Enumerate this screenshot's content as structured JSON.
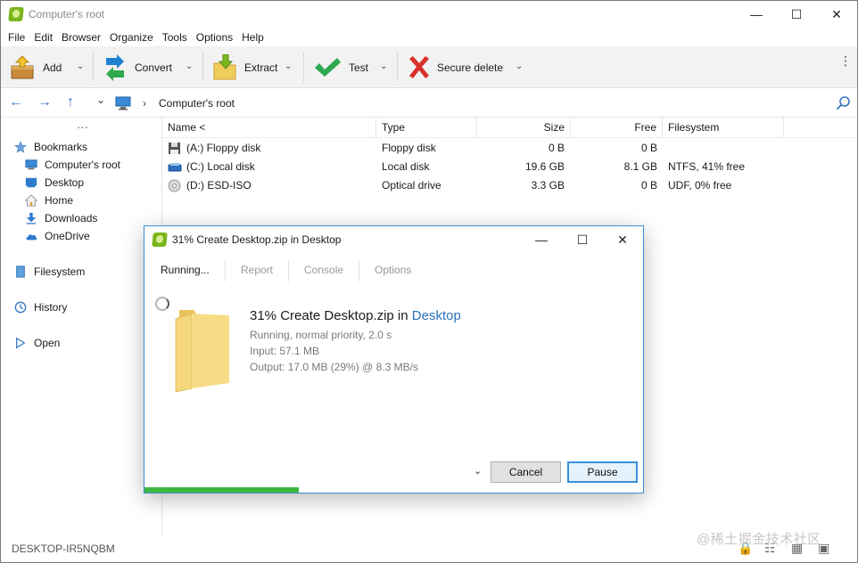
{
  "window": {
    "title": "Computer's root",
    "controls": {
      "minimize": "—",
      "maximize": "☐",
      "close": "✕"
    }
  },
  "menu": [
    "File",
    "Edit",
    "Browser",
    "Organize",
    "Tools",
    "Options",
    "Help"
  ],
  "toolbar": {
    "add": "Add",
    "convert": "Convert",
    "extract": "Extract",
    "test": "Test",
    "secure_delete": "Secure delete",
    "dropdown_glyph": "⌄",
    "more_glyph": "⋮"
  },
  "addressbar": {
    "back_glyph": "←",
    "forward_glyph": "→",
    "up_glyph": "↑",
    "history_glyph": "⌄",
    "separator_glyph": "›",
    "path": "Computer's root",
    "search_glyph": "⚲"
  },
  "sidebar": {
    "more_glyph": "···",
    "bookmarks_label": "Bookmarks",
    "bookmarks": [
      "Computer's root",
      "Desktop",
      "Home",
      "Downloads",
      "OneDrive"
    ],
    "filesystem_label": "Filesystem",
    "history_label": "History",
    "open_label": "Open"
  },
  "columns": [
    "Name <",
    "Type",
    "Size",
    "Free",
    "Filesystem"
  ],
  "rows": [
    {
      "name": "(A:) Floppy disk",
      "type": "Floppy disk",
      "size": "0 B",
      "free": "0 B",
      "filesystem": "",
      "icon": "floppy-icon"
    },
    {
      "name": "(C:) Local disk",
      "type": "Local disk",
      "size": "19.6 GB",
      "free": "8.1 GB",
      "filesystem": "NTFS, 41% free",
      "icon": "drive-icon"
    },
    {
      "name": "(D:) ESD-ISO",
      "type": "Optical drive",
      "size": "3.3 GB",
      "free": "0 B",
      "filesystem": "UDF, 0% free",
      "icon": "disc-icon"
    }
  ],
  "status": {
    "computer_name": "DESKTOP-IR5NQBM"
  },
  "dialog": {
    "title": "31% Create Desktop.zip in Desktop",
    "controls": {
      "minimize": "—",
      "maximize": "☐",
      "close": "✕"
    },
    "tabs": [
      "Running...",
      "Report",
      "Console",
      "Options"
    ],
    "job_title_prefix": "31% Create Desktop.zip in ",
    "job_title_link": "Desktop",
    "status_line": "Running, normal priority, 2.0 s",
    "input_line": "Input: 57.1 MB",
    "output_line": "Output: 17.0 MB (29%) @ 8.3 MB/s",
    "more_glyph": "⌄",
    "cancel_label": "Cancel",
    "pause_label": "Pause",
    "progress": 0.31
  },
  "watermark": "@稀土掘金技术社区",
  "colors": {
    "accent": "#2b73bd",
    "progress": "#3fb63f",
    "dialog_border": "#3c8fd8",
    "toolbar_bg": "#f2f2f2"
  }
}
